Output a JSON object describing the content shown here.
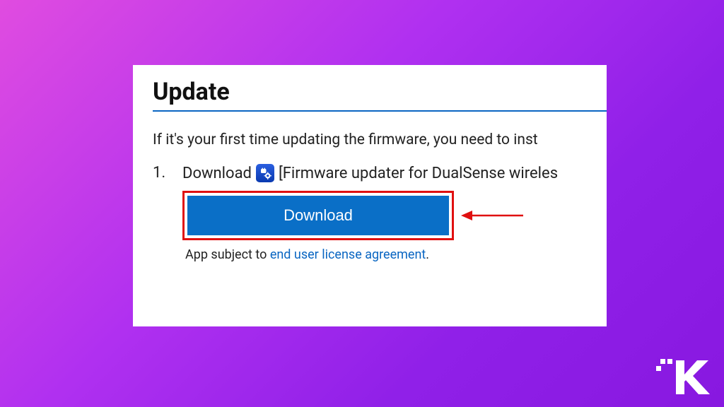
{
  "heading": "Update",
  "intro": "If it's your first time updating the firmware, you need to inst",
  "step": {
    "number": "1.",
    "lead": "Download",
    "trail": "[Firmware updater for DualSense wireles"
  },
  "button": {
    "label": "Download"
  },
  "legal": {
    "prefix": "App subject to ",
    "link": "end user license agreement",
    "suffix": "."
  }
}
